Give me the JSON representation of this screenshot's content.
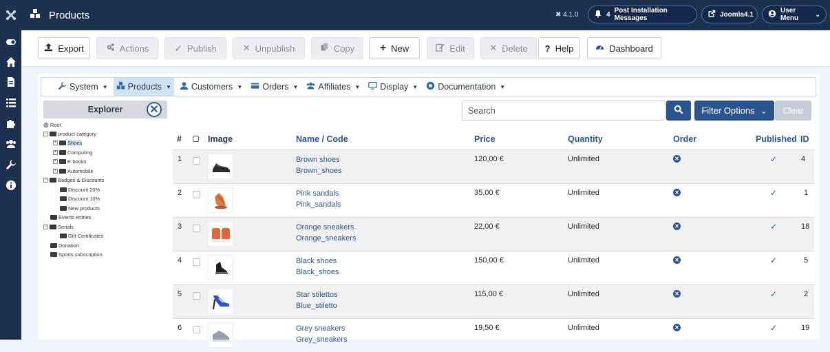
{
  "header": {
    "title": "Products",
    "version": "4.1.0",
    "notifications_count": "4",
    "notifications_label": "Post Installation Messages",
    "site_label": "Joomla4.1",
    "user_label": "User Menu"
  },
  "sidebar": {
    "items": [
      "toggle-icon",
      "home-icon",
      "file-icon",
      "list-icon",
      "puzzle-icon",
      "users-icon",
      "wrench-icon",
      "info-icon"
    ]
  },
  "toolbar": {
    "export": "Export",
    "actions": "Actions",
    "publish": "Publish",
    "unpublish": "Unpublish",
    "copy": "Copy",
    "new": "New",
    "edit": "Edit",
    "delete": "Delete",
    "help": "Help",
    "dashboard": "Dashboard"
  },
  "menu": {
    "system": "System",
    "products": "Products",
    "customers": "Customers",
    "orders": "Orders",
    "affiliates": "Affiliates",
    "display": "Display",
    "documentation": "Documentation"
  },
  "explorer": {
    "title": "Explorer",
    "tree": {
      "root": "Root",
      "product_category": "product category",
      "shoes": "Shoes",
      "computing": "Computing",
      "ebooks": "E-books",
      "automobile": "Automobile",
      "badges": "Badges & Discounts",
      "discount20": "Discount 20%",
      "discount10": "Discount 10%",
      "new_products": "New products",
      "events": "Events entries",
      "serials": "Serials",
      "gift": "Gift Certificates",
      "donation": "Donation",
      "sports": "Sports subscription"
    }
  },
  "search": {
    "placeholder": "Search",
    "filter_options": "Filter Options",
    "clear": "Clear"
  },
  "table": {
    "headers": {
      "num": "#",
      "image": "Image",
      "name": "Name / Code",
      "price": "Price",
      "quantity": "Quantity",
      "order": "Order",
      "published": "Published",
      "id": "ID"
    },
    "rows": [
      {
        "num": "1",
        "name": "Brown shoes",
        "code": "Brown_shoes",
        "price": "120,00 €",
        "quantity": "Unlimited",
        "id": "4"
      },
      {
        "num": "2",
        "name": "Pink sandals",
        "code": "Pink_sandals",
        "price": "35,00 €",
        "quantity": "Unlimited",
        "id": "1"
      },
      {
        "num": "3",
        "name": "Orange sneakers",
        "code": "Orange_sneakers",
        "price": "22,00 €",
        "quantity": "Unlimited",
        "id": "18"
      },
      {
        "num": "4",
        "name": "Black shoes",
        "code": "Black_shoes",
        "price": "150,00 €",
        "quantity": "Unlimited",
        "id": "5"
      },
      {
        "num": "5",
        "name": "Star stilettos",
        "code": "Blue_stiletto",
        "price": "115,00 €",
        "quantity": "Unlimited",
        "id": "2"
      },
      {
        "num": "6",
        "name": "Grey sneakers",
        "code": "Grey_sneakers",
        "price": "19,50 €",
        "quantity": "Unlimited",
        "id": "19"
      }
    ]
  },
  "colors": {
    "nav_dark": "#1c3150",
    "accent": "#2a5590",
    "menu_active": "#cfe3f6"
  }
}
